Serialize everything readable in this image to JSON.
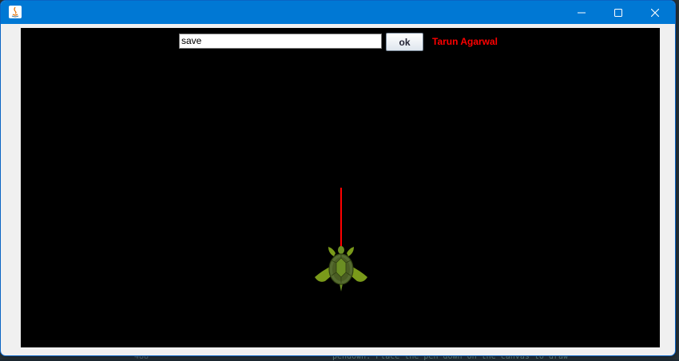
{
  "window": {
    "title": "",
    "controls": [
      "minimize-icon",
      "maximize-icon",
      "close-icon"
    ]
  },
  "toolbar": {
    "command_value": "save",
    "ok_label": "ok",
    "author": "Tarun Agarwal"
  },
  "canvas": {
    "background": "#000000",
    "pen_color": "#ff0000",
    "turtle_color": "#6b8e23"
  },
  "colors": {
    "titlebar": "#0078d4",
    "author_text": "#ff0000"
  },
  "background_ide": {
    "line_number": "488",
    "code_text": "\"pendown: Place the pen down on the canvas to draw\""
  }
}
